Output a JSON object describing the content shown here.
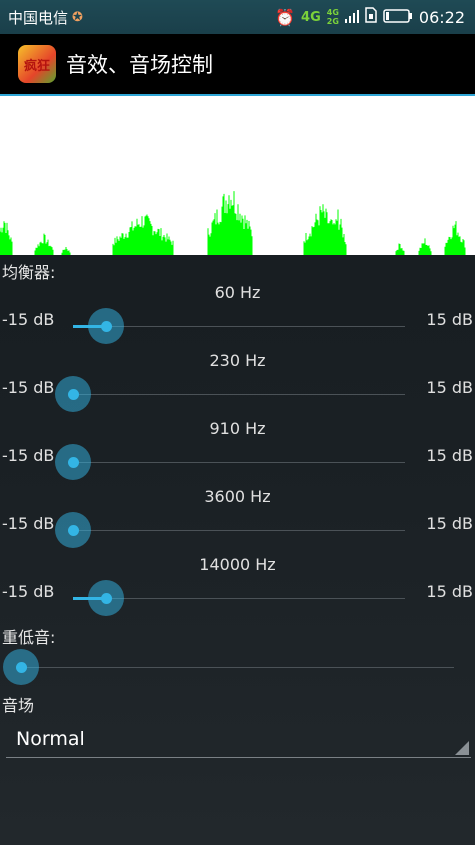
{
  "status_bar": {
    "carrier": "中国电信",
    "network_4g": "4G",
    "network_4g_small": "4G",
    "network_2g_small": "2G",
    "time": "06:22"
  },
  "app_bar": {
    "icon_text": "疯狂",
    "title": "音效、音场控制"
  },
  "visualizer": {
    "bar_color": "#00ff00",
    "background": "#ffffff"
  },
  "equalizer": {
    "label": "均衡器:",
    "bands": [
      {
        "freq": "60 Hz",
        "min_label": "-15 dB",
        "max_label": "15 dB",
        "level": 0.1
      },
      {
        "freq": "230 Hz",
        "min_label": "-15 dB",
        "max_label": "15 dB",
        "level": 0.0
      },
      {
        "freq": "910 Hz",
        "min_label": "-15 dB",
        "max_label": "15 dB",
        "level": 0.0
      },
      {
        "freq": "3600 Hz",
        "min_label": "-15 dB",
        "max_label": "15 dB",
        "level": 0.0
      },
      {
        "freq": "14000 Hz",
        "min_label": "-15 dB",
        "max_label": "15 dB",
        "level": 0.1
      }
    ]
  },
  "bass_boost": {
    "label": "重低音:",
    "level": 0.0
  },
  "sound_field": {
    "label": "音场",
    "selected": "Normal"
  },
  "accent_color": "#33b5e5"
}
